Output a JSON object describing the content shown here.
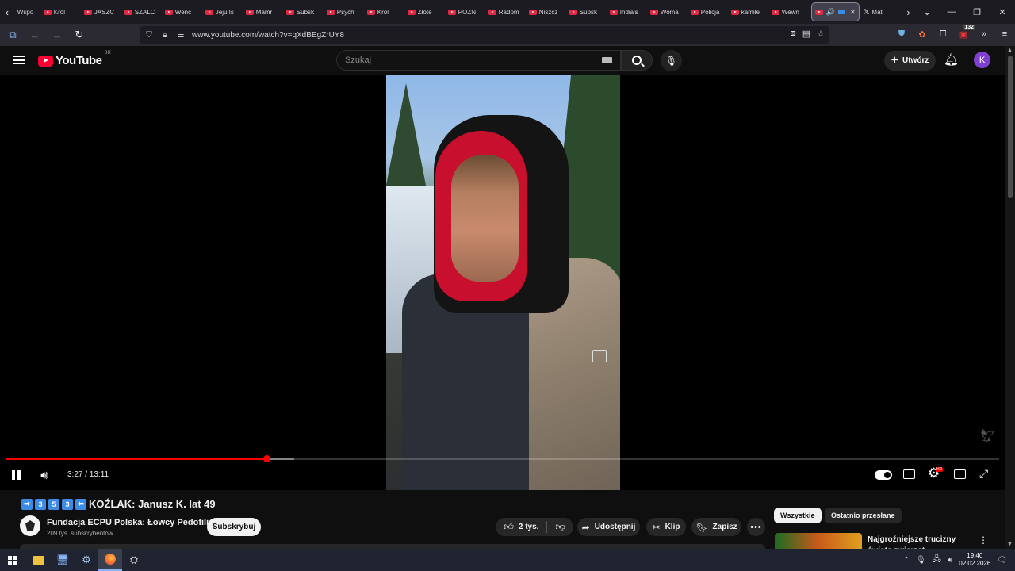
{
  "browser": {
    "tabs": [
      {
        "label": "Wspó",
        "type": "plain"
      },
      {
        "label": "Król",
        "type": "yt"
      },
      {
        "label": "JASZC",
        "type": "yt"
      },
      {
        "label": "SZALC",
        "type": "yt"
      },
      {
        "label": "Wenc",
        "type": "yt"
      },
      {
        "label": "Jeju Is",
        "type": "yt"
      },
      {
        "label": "Mamr",
        "type": "yt"
      },
      {
        "label": "Subsk",
        "type": "yt"
      },
      {
        "label": "Psych",
        "type": "yt"
      },
      {
        "label": "Król",
        "type": "yt"
      },
      {
        "label": "Złote",
        "type": "yt"
      },
      {
        "label": "POZN",
        "type": "yt"
      },
      {
        "label": "Radom",
        "type": "yt"
      },
      {
        "label": "Niszcz",
        "type": "yt"
      },
      {
        "label": "Subsk",
        "type": "yt"
      },
      {
        "label": "India's",
        "type": "yt"
      },
      {
        "label": "Woma",
        "type": "yt"
      },
      {
        "label": "Policja",
        "type": "yt"
      },
      {
        "label": "kamile",
        "type": "yt"
      },
      {
        "label": "Wewn",
        "type": "yt"
      }
    ],
    "active_tab_close": "✕",
    "x_tab_label": "Mat",
    "url": "www.youtube.com/watch?v=qXdBEgZrUY8"
  },
  "youtube": {
    "logo_text": "YouTube",
    "logo_region": "BR",
    "search_placeholder": "Szukaj",
    "create_label": "Utwórz",
    "avatar_letter": "K"
  },
  "player": {
    "current_time": "3:27",
    "duration": "13:11",
    "time_display": "3:27 / 13:11",
    "progress_fraction": 0.262,
    "buffer_fraction": 0.29,
    "hd_badge": "HD"
  },
  "video": {
    "title_prefix_boxes": [
      "3",
      "5",
      "3"
    ],
    "title_arrow_left": "➡",
    "title_arrow_right": "⬅",
    "title": "KOŹLAK: Janusz K. lat 49",
    "channel_name": "Fundacja ECPU Polska: Łowcy Pedofili",
    "subscribers": "209 tys. subskrybentów",
    "subscribe_label": "Subskrybuj",
    "likes": "2 tys.",
    "share_label": "Udostępnij",
    "clip_label": "Klip",
    "save_label": "Zapisz"
  },
  "sidebar": {
    "chips": [
      "Wszystkie",
      "Ostatnio przesłane"
    ],
    "rec_title": "Najgroźniejsze trucizny świata zwierząt"
  },
  "taskbar": {
    "time": "19:40",
    "date": "02.02.2026"
  },
  "colors": {
    "yt_red": "#ff0033",
    "progress_red": "#ff0000",
    "accent_blue": "#3c8ce7",
    "avatar_purple": "#7f3fd1"
  }
}
